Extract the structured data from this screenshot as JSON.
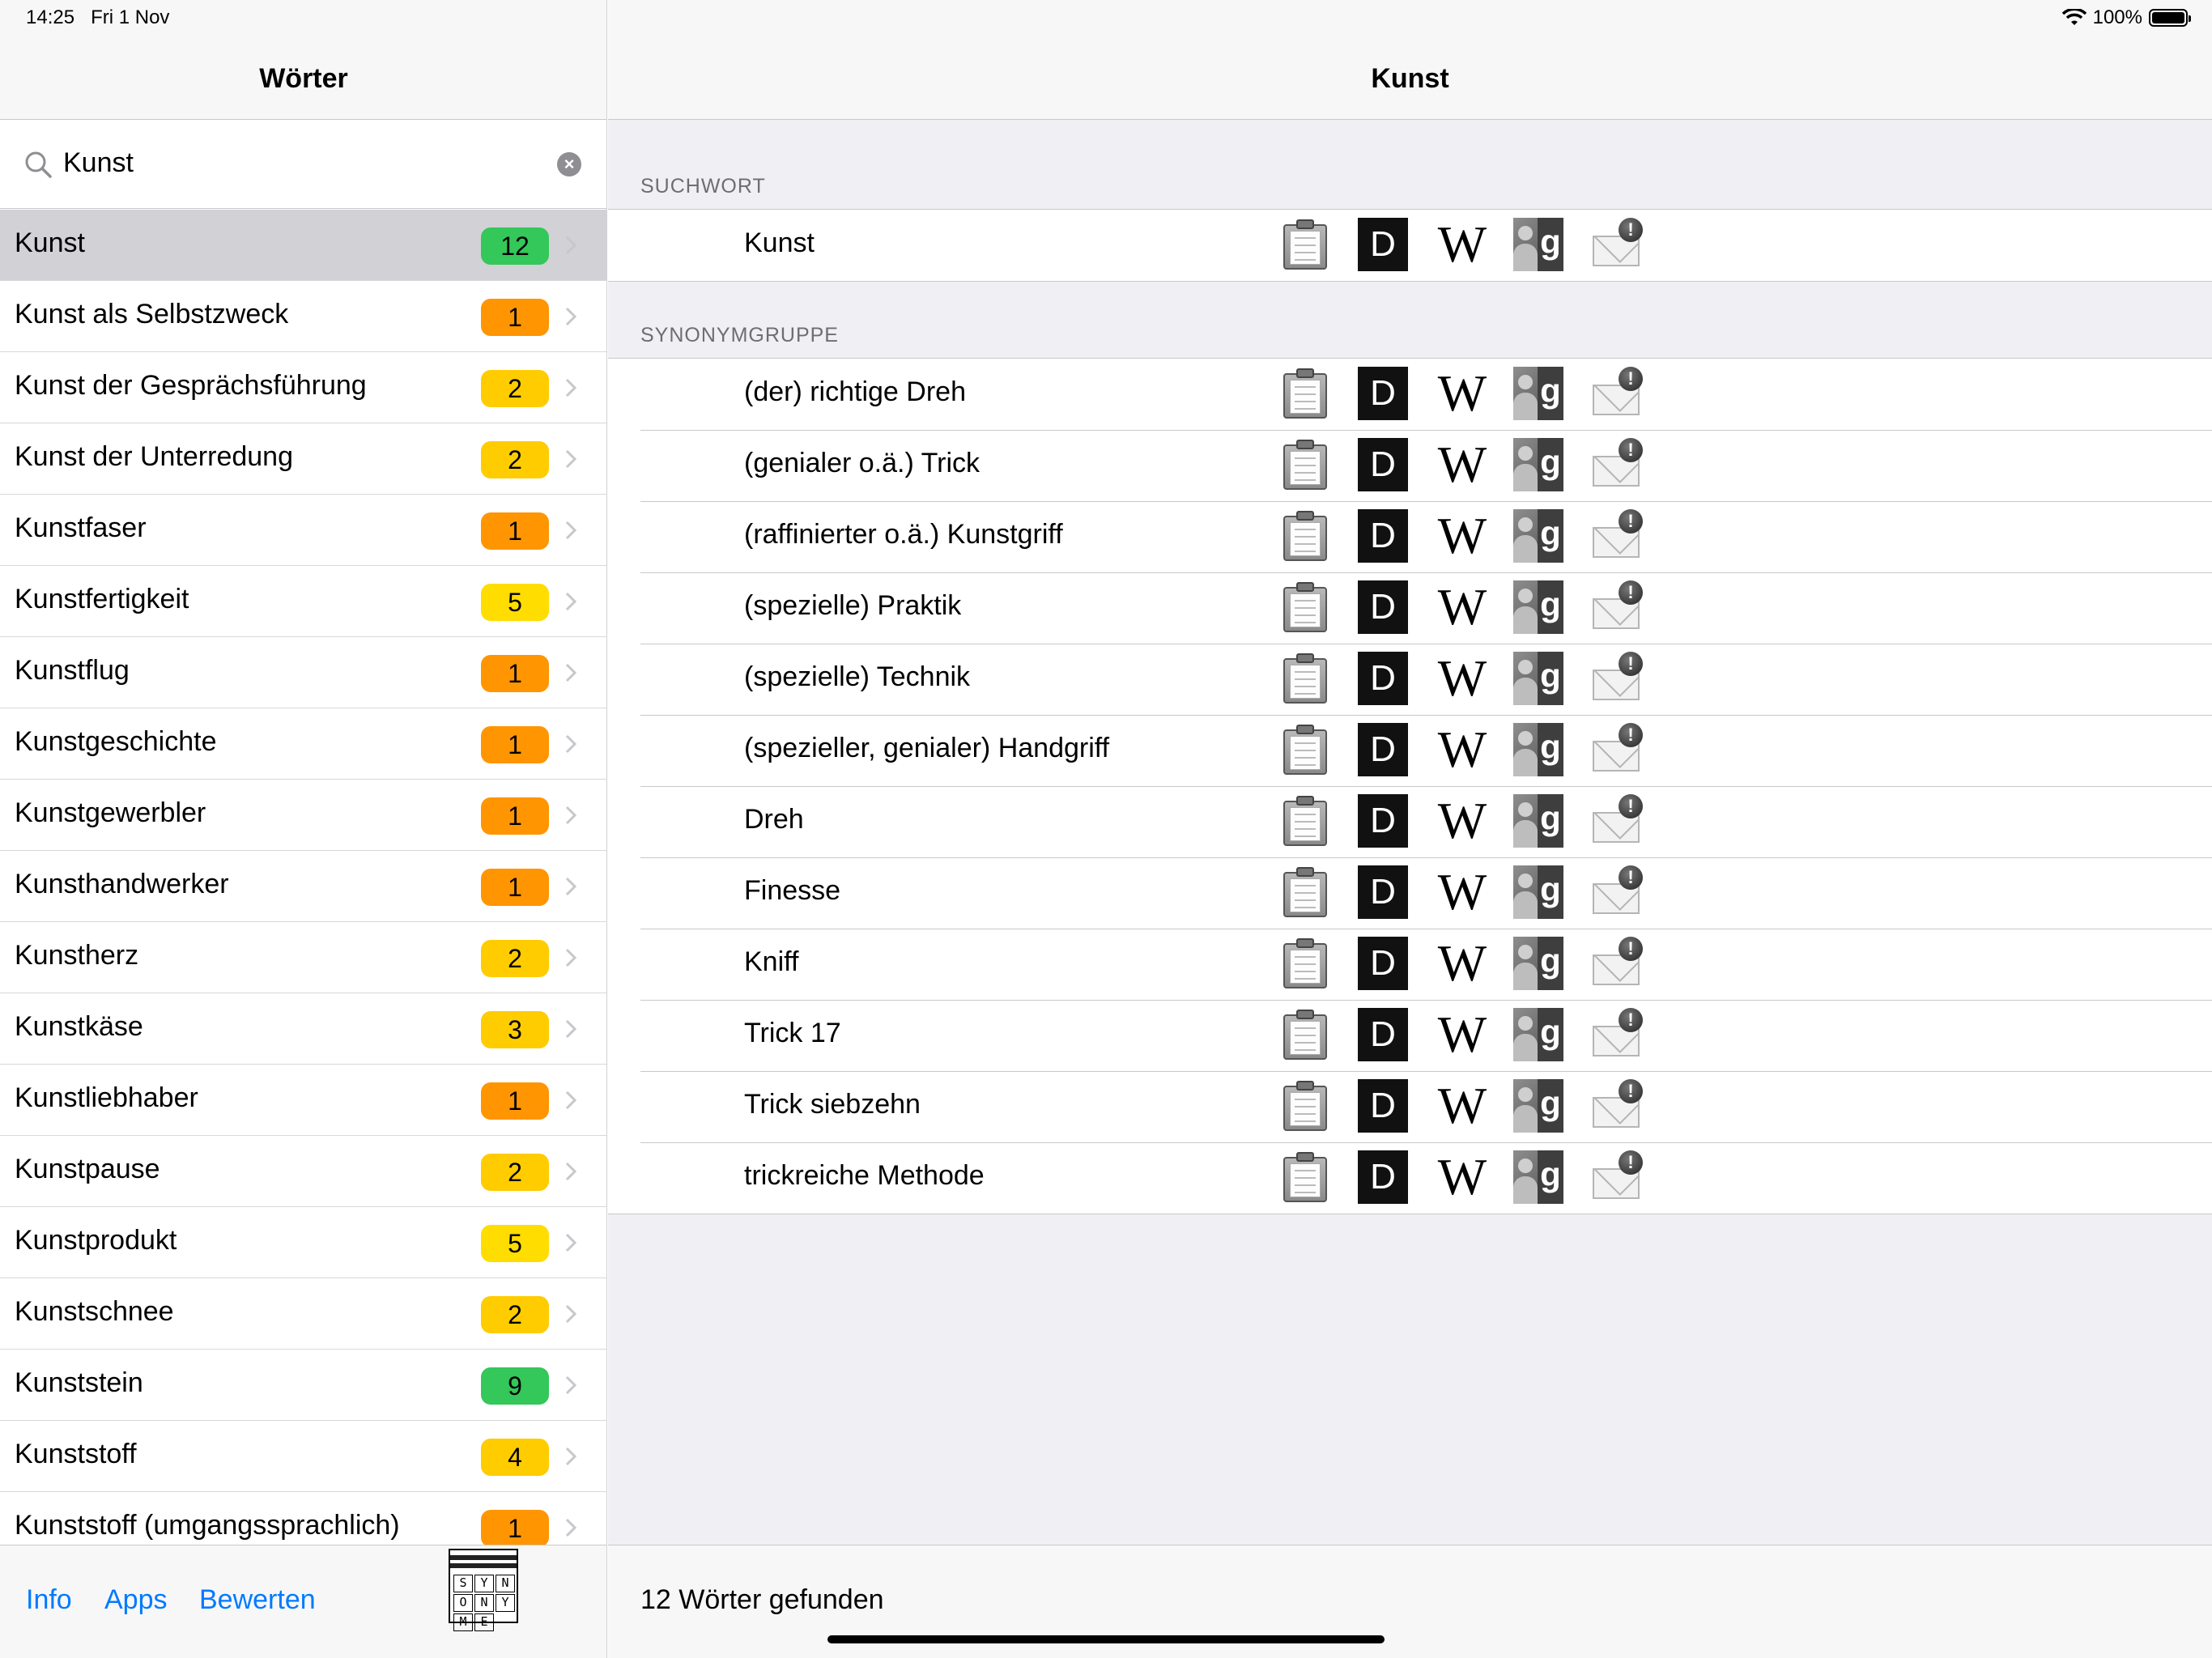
{
  "status_bar": {
    "time": "14:25",
    "date": "Fri 1 Nov",
    "battery": "100%"
  },
  "sidebar": {
    "title": "Wörter",
    "search": {
      "value": "Kunst"
    },
    "items": [
      {
        "label": "Kunst",
        "count": "12",
        "color": "#34c759",
        "selected": true
      },
      {
        "label": "Kunst als Selbstzweck",
        "count": "1",
        "color": "#ff9500"
      },
      {
        "label": "Kunst der Gesprächsführung",
        "count": "2",
        "color": "#ffcc00"
      },
      {
        "label": "Kunst der Unterredung",
        "count": "2",
        "color": "#ffcc00"
      },
      {
        "label": "Kunstfaser",
        "count": "1",
        "color": "#ff9500"
      },
      {
        "label": "Kunstfertigkeit",
        "count": "5",
        "color": "#ffdd00"
      },
      {
        "label": "Kunstflug",
        "count": "1",
        "color": "#ff9500"
      },
      {
        "label": "Kunstgeschichte",
        "count": "1",
        "color": "#ff9500"
      },
      {
        "label": "Kunstgewerbler",
        "count": "1",
        "color": "#ff9500"
      },
      {
        "label": "Kunsthandwerker",
        "count": "1",
        "color": "#ff9500"
      },
      {
        "label": "Kunstherz",
        "count": "2",
        "color": "#ffcc00"
      },
      {
        "label": "Kunstkäse",
        "count": "3",
        "color": "#ffcc00"
      },
      {
        "label": "Kunstliebhaber",
        "count": "1",
        "color": "#ff9500"
      },
      {
        "label": "Kunstpause",
        "count": "2",
        "color": "#ffcc00"
      },
      {
        "label": "Kunstprodukt",
        "count": "5",
        "color": "#ffdd00"
      },
      {
        "label": "Kunstschnee",
        "count": "2",
        "color": "#ffcc00"
      },
      {
        "label": "Kunststein",
        "count": "9",
        "color": "#34c759"
      },
      {
        "label": "Kunststoff",
        "count": "4",
        "color": "#ffcc00"
      },
      {
        "label": "Kunststoff (umgangssprachlich)",
        "count": "1",
        "color": "#ff9500"
      }
    ],
    "toolbar": {
      "info": "Info",
      "apps": "Apps",
      "rate": "Bewerten",
      "logo_letters": [
        "S",
        "Y",
        "N",
        "O",
        "N",
        "Y",
        "M",
        "E"
      ]
    }
  },
  "detail": {
    "title": "Kunst",
    "search_section": {
      "header": "SUCHWORT",
      "word": "Kunst"
    },
    "synonym_section": {
      "header": "SYNONYMGRUPPE",
      "words": [
        "(der) richtige Dreh",
        "(genialer o.ä.) Trick",
        "(raffinierter o.ä.) Kunstgriff",
        "(spezielle) Praktik",
        "(spezielle) Technik",
        "(spezieller, genialer) Handgriff",
        "Dreh",
        "Finesse",
        "Kniff",
        "Trick 17",
        "Trick siebzehn",
        "trickreiche Methode"
      ]
    },
    "action_icons": {
      "duden": "D",
      "wikipedia": "W",
      "google": "g",
      "report": "!"
    },
    "status": "12 Wörter gefunden"
  }
}
